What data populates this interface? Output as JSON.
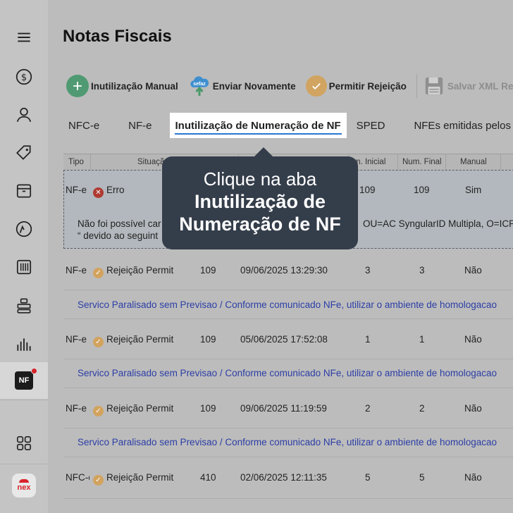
{
  "page": {
    "title": "Notas Fiscais"
  },
  "sidebar": {
    "items": [
      {
        "icon": "menu-icon"
      },
      {
        "icon": "dollar-icon"
      },
      {
        "icon": "user-icon"
      },
      {
        "icon": "tag-icon"
      },
      {
        "icon": "box-icon"
      },
      {
        "icon": "gauge-icon"
      },
      {
        "icon": "barcode-icon"
      },
      {
        "icon": "network-icon"
      },
      {
        "icon": "chart-icon"
      },
      {
        "icon": "nf-icon",
        "badge": "NF",
        "active": true
      },
      {
        "icon": "apps-icon"
      },
      {
        "icon": "nex-logo",
        "label": "nex"
      }
    ]
  },
  "toolbar": {
    "inutilizacao": "Inutilização Manual",
    "enviar": "Enviar Novamente",
    "sefaz_badge": "sefaz",
    "permitir": "Permitir Rejeição",
    "salvar": "Salvar XML Retorn"
  },
  "tabs": [
    "NFC-e",
    "NF-e",
    "Inutilização de Numeração de NF",
    "SPED",
    "NFEs emitidas pelos Fo"
  ],
  "table": {
    "headers": [
      "Tipo",
      "Situação",
      "m. Inicial",
      "Num. Final",
      "Manual"
    ],
    "rows": [
      {
        "tipo": "NF-e",
        "situacao": "Erro",
        "serie": "",
        "data": "",
        "inicial": "109",
        "final": "109",
        "manual": "Sim",
        "message": "Não foi possível car",
        "message2": "“ devido ao seguint",
        "message_right": "OU=AC SyngularID Multipla, O=ICP"
      },
      {
        "tipo": "NF-e",
        "situacao": "Rejeição Permit",
        "serie": "109",
        "data": "09/06/2025 13:29:30",
        "inicial": "3",
        "final": "3",
        "manual": "Não",
        "message": "Servico Paralisado sem Previsao  / Conforme comunicado NFe, utilizar o ambiente de homologacao"
      },
      {
        "tipo": "NF-e",
        "situacao": "Rejeição Permit",
        "serie": "109",
        "data": "05/06/2025 17:52:08",
        "inicial": "1",
        "final": "1",
        "manual": "Não",
        "message": "Servico Paralisado sem Previsao  / Conforme comunicado NFe, utilizar o ambiente de homologacao"
      },
      {
        "tipo": "NF-e",
        "situacao": "Rejeição Permit",
        "serie": "109",
        "data": "09/06/2025 11:19:59",
        "inicial": "2",
        "final": "2",
        "manual": "Não",
        "message": "Servico Paralisado sem Previsao  / Conforme comunicado NFe, utilizar o ambiente de homologacao"
      },
      {
        "tipo": "NFC-e",
        "situacao": "Rejeição Permit",
        "serie": "410",
        "data": "02/06/2025 12:11:35",
        "inicial": "5",
        "final": "5",
        "manual": "Não"
      }
    ]
  },
  "callout": {
    "line1": "Clique na aba",
    "line2": "Inutilização de",
    "line3": "Numeração de NF"
  }
}
